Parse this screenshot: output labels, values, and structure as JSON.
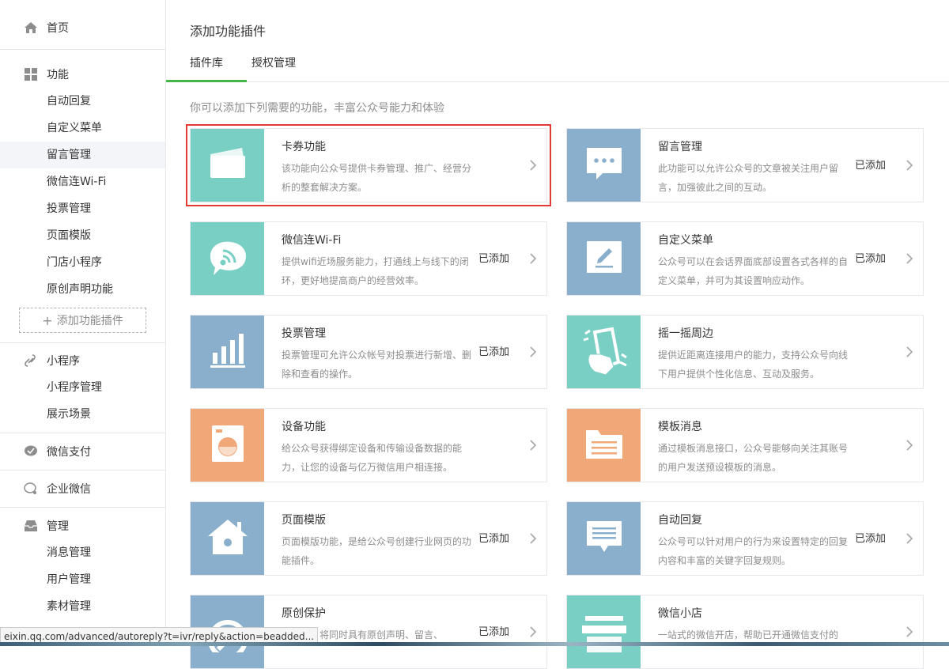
{
  "sidebar": {
    "home": {
      "label": "首页",
      "icon": "home-icon"
    },
    "function": {
      "label": "功能",
      "icon": "grid-icon",
      "items": [
        "自动回复",
        "自定义菜单",
        "留言管理",
        "微信连Wi-Fi",
        "投票管理",
        "页面模版",
        "门店小程序",
        "原创声明功能"
      ],
      "active_index": 2,
      "add_label": "添加功能插件"
    },
    "miniprogram": {
      "label": "小程序",
      "icon": "link-icon",
      "items": [
        "小程序管理",
        "展示场景"
      ]
    },
    "pay": {
      "label": "微信支付",
      "icon": "wechat-pay-icon"
    },
    "work": {
      "label": "企业微信",
      "icon": "work-wechat-icon"
    },
    "manage": {
      "label": "管理",
      "icon": "inbox-icon",
      "items": [
        "消息管理",
        "用户管理",
        "素材管理"
      ]
    }
  },
  "main": {
    "title": "添加功能插件",
    "tabs": [
      "插件库",
      "授权管理"
    ],
    "intro": "你可以添加下列需要的功能，丰富公众号能力和体验",
    "plugins": [
      {
        "name": "卡券功能",
        "desc": "该功能向公众号提供卡券管理、推广、经营分析的整套解决方案。",
        "status": "",
        "color": "#7acfc4",
        "icon": "card-icon"
      },
      {
        "name": "留言管理",
        "desc": "此功能可以允许公众号的文章被关注用户留言，加强彼此之间的互动。",
        "status": "已添加",
        "color": "#8aafcc",
        "icon": "comment-icon"
      },
      {
        "name": "微信连Wi-Fi",
        "desc": "提供wifi近场服务能力，打通线上与线下的闭环，更好地提高商户的经营效率。",
        "status": "已添加",
        "color": "#7acfc4",
        "icon": "wifi-icon"
      },
      {
        "name": "自定义菜单",
        "desc": "公众号可以在会话界面底部设置各式各样的自定义菜单，并可为其设置响应动作。",
        "status": "已添加",
        "color": "#8aafcc",
        "icon": "edit-icon"
      },
      {
        "name": "投票管理",
        "desc": "投票管理可允许公众帐号对投票进行新增、删除和查看的操作。",
        "status": "已添加",
        "color": "#8aafcc",
        "icon": "bar-chart-icon"
      },
      {
        "name": "摇一摇周边",
        "desc": "提供近距离连接用户的能力，支持公众号向线下用户提供个性化信息、互动及服务。",
        "status": "",
        "color": "#7acfc4",
        "icon": "shake-phone-icon"
      },
      {
        "name": "设备功能",
        "desc": "给公众号获得绑定设备和传输设备数据的能力，让您的设备与亿万微信用户相连接。",
        "status": "",
        "color": "#f0a878",
        "icon": "washer-icon"
      },
      {
        "name": "模板消息",
        "desc": "通过模板消息接口，公众号能够向关注其账号的用户发送预设模板的消息。",
        "status": "",
        "color": "#f0a878",
        "icon": "folder-icon"
      },
      {
        "name": "页面模版",
        "desc": "页面模版功能，是给公众号创建行业网页的功能插件。",
        "status": "已添加",
        "color": "#8aafcc",
        "icon": "house-icon"
      },
      {
        "name": "自动回复",
        "desc": "公众号可以针对用户的行为来设置特定的回复内容和丰富的关键字回复规则。",
        "status": "已添加",
        "color": "#8aafcc",
        "icon": "message-icon"
      },
      {
        "name": "原创保护",
        "desc": "成功后，将同时具有原创声明、留言、",
        "status": "已添加",
        "color": "#8aafcc",
        "icon": "original-icon"
      },
      {
        "name": "微信小店",
        "desc": "一站式的微信开店，帮助已开通微信支付的",
        "status": "",
        "color": "#7acfc4",
        "icon": "shop-icon"
      }
    ]
  },
  "statusbar": {
    "url": "eixin.qq.com/advanced/autoreply?t=ivr/reply&action=beadded..."
  }
}
